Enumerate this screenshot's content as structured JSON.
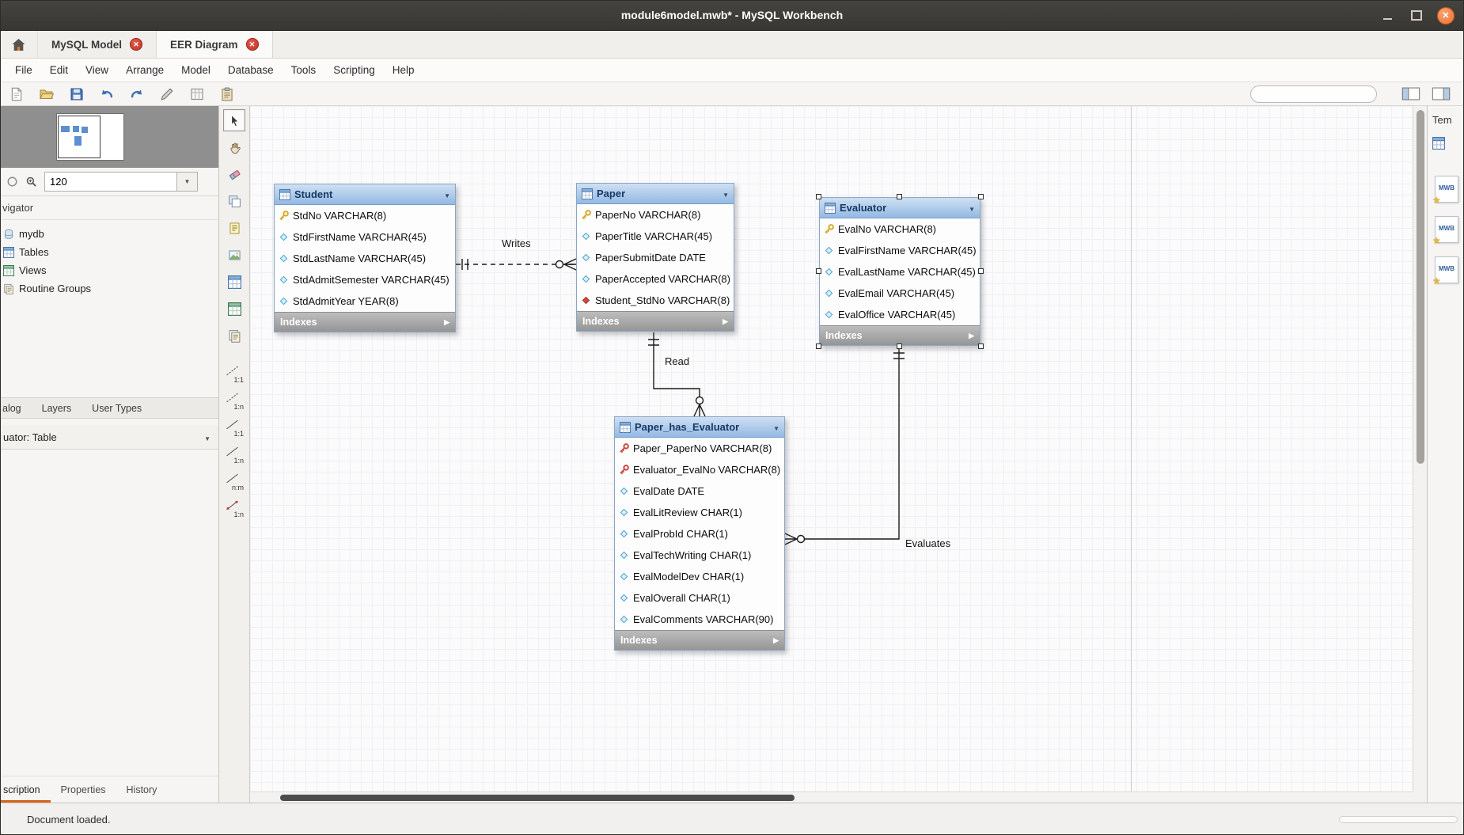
{
  "colors": {
    "titlebar": "#3c3a36",
    "close_button": "#ec6e2e",
    "tab_close": "#c23428",
    "table_header_top": "#cfe0f2",
    "table_header_bottom": "#93b9e4",
    "indexes_bar": "#a3a3a3",
    "active_tab_underline": "#d4641f"
  },
  "window": {
    "title": "module6model.mwb* - MySQL Workbench"
  },
  "tabbar": {
    "tabs": [
      {
        "label": "MySQL Model",
        "active": false
      },
      {
        "label": "EER Diagram",
        "active": true
      }
    ]
  },
  "menubar": {
    "items": [
      "File",
      "Edit",
      "View",
      "Arrange",
      "Model",
      "Database",
      "Tools",
      "Scripting",
      "Help"
    ]
  },
  "toolbar": {
    "buttons": [
      {
        "icon": "new-document-icon"
      },
      {
        "icon": "open-folder-icon"
      },
      {
        "icon": "save-icon"
      },
      {
        "icon": "undo-icon"
      },
      {
        "icon": "redo-icon"
      },
      {
        "icon": "edit-icon"
      },
      {
        "icon": "grid-icon"
      },
      {
        "icon": "clipboard-icon"
      }
    ],
    "search": {
      "value": ""
    },
    "panel_toggles": [
      {
        "icon": "toggle-left-panel-icon"
      },
      {
        "icon": "toggle-right-panel-icon"
      }
    ]
  },
  "sidebar": {
    "zoom": {
      "value": "120"
    },
    "navigator_label": "vigator",
    "tree": [
      {
        "label": "mydb",
        "icon": "schema-icon"
      },
      {
        "label": "Tables",
        "icon": "tables-icon"
      },
      {
        "label": "Views",
        "icon": "views-icon"
      },
      {
        "label": "Routine Groups",
        "icon": "routine-groups-icon"
      }
    ],
    "panel_tabs": [
      {
        "label": "alog"
      },
      {
        "label": "Layers"
      },
      {
        "label": "User Types"
      }
    ],
    "selection_combo": {
      "label": "uator: Table"
    },
    "bottom_tabs": [
      {
        "label": "scription",
        "active": true
      },
      {
        "label": "Properties",
        "active": false
      },
      {
        "label": "History",
        "active": false
      }
    ]
  },
  "tool_palette": {
    "tools": [
      {
        "name": "select",
        "icon": "cursor-icon",
        "active": true
      },
      {
        "name": "pan",
        "icon": "hand-icon",
        "active": false
      },
      {
        "name": "delete",
        "icon": "eraser-icon",
        "active": false
      },
      {
        "name": "place-layer",
        "icon": "layer-icon",
        "active": false
      },
      {
        "name": "place-note",
        "icon": "note-icon",
        "active": false
      },
      {
        "name": "place-image",
        "icon": "image-icon",
        "active": false
      },
      {
        "name": "place-table",
        "icon": "table-icon",
        "active": false
      },
      {
        "name": "place-view",
        "icon": "view-icon",
        "active": false
      },
      {
        "name": "place-routine-group",
        "icon": "routine-group-icon",
        "active": false
      }
    ],
    "relationship_tools": [
      {
        "label": "1:1",
        "line": "dashed"
      },
      {
        "label": "1:n",
        "line": "dashed"
      },
      {
        "label": "1:1",
        "line": "solid"
      },
      {
        "label": "1:n",
        "line": "solid"
      },
      {
        "label": "n:m",
        "line": "solid"
      },
      {
        "label": "1:n",
        "line": "existing"
      }
    ]
  },
  "diagram": {
    "tables": [
      {
        "name": "Student",
        "selected": false,
        "columns": [
          {
            "icon": "key-yellow",
            "text": "StdNo VARCHAR(8)"
          },
          {
            "icon": "diamond-blue",
            "text": "StdFirstName VARCHAR(45)"
          },
          {
            "icon": "diamond-blue",
            "text": "StdLastName VARCHAR(45)"
          },
          {
            "icon": "diamond-blue",
            "text": "StdAdmitSemester VARCHAR(45)"
          },
          {
            "icon": "diamond-blue",
            "text": "StdAdmitYear YEAR(8)"
          }
        ],
        "footer": "Indexes"
      },
      {
        "name": "Paper",
        "selected": false,
        "columns": [
          {
            "icon": "key-yellow",
            "text": "PaperNo VARCHAR(8)"
          },
          {
            "icon": "diamond-blue",
            "text": "PaperTitle VARCHAR(45)"
          },
          {
            "icon": "diamond-blue",
            "text": "PaperSubmitDate DATE"
          },
          {
            "icon": "diamond-blue",
            "text": "PaperAccepted VARCHAR(8)"
          },
          {
            "icon": "diamond-red",
            "text": "Student_StdNo VARCHAR(8)"
          }
        ],
        "footer": "Indexes"
      },
      {
        "name": "Evaluator",
        "selected": true,
        "columns": [
          {
            "icon": "key-yellow",
            "text": "EvalNo VARCHAR(8)"
          },
          {
            "icon": "diamond-blue",
            "text": "EvalFirstName VARCHAR(45)"
          },
          {
            "icon": "diamond-blue",
            "text": "EvalLastName VARCHAR(45)"
          },
          {
            "icon": "diamond-blue",
            "text": "EvalEmail VARCHAR(45)"
          },
          {
            "icon": "diamond-blue",
            "text": "EvalOffice VARCHAR(45)"
          }
        ],
        "footer": "Indexes"
      },
      {
        "name": "Paper_has_Evaluator",
        "selected": false,
        "columns": [
          {
            "icon": "key-red",
            "text": "Paper_PaperNo VARCHAR(8)"
          },
          {
            "icon": "key-red",
            "text": "Evaluator_EvalNo VARCHAR(8)"
          },
          {
            "icon": "diamond-blue",
            "text": "EvalDate DATE"
          },
          {
            "icon": "diamond-blue",
            "text": "EvalLitReview CHAR(1)"
          },
          {
            "icon": "diamond-blue",
            "text": "EvalProbId CHAR(1)"
          },
          {
            "icon": "diamond-blue",
            "text": "EvalTechWriting CHAR(1)"
          },
          {
            "icon": "diamond-blue",
            "text": "EvalModelDev CHAR(1)"
          },
          {
            "icon": "diamond-blue",
            "text": "EvalOverall CHAR(1)"
          },
          {
            "icon": "diamond-blue",
            "text": "EvalComments VARCHAR(90)"
          }
        ],
        "footer": "Indexes"
      }
    ],
    "relationships": [
      {
        "label": "Writes",
        "style": "dashed"
      },
      {
        "label": "Read",
        "style": "solid"
      },
      {
        "label": "Evaluates",
        "style": "solid"
      }
    ]
  },
  "right_panel": {
    "title": "Tem",
    "files": [
      {
        "badge": "MWB"
      },
      {
        "badge": "MWB"
      },
      {
        "badge": "MWB"
      }
    ]
  },
  "statusbar": {
    "text": "Document loaded."
  }
}
